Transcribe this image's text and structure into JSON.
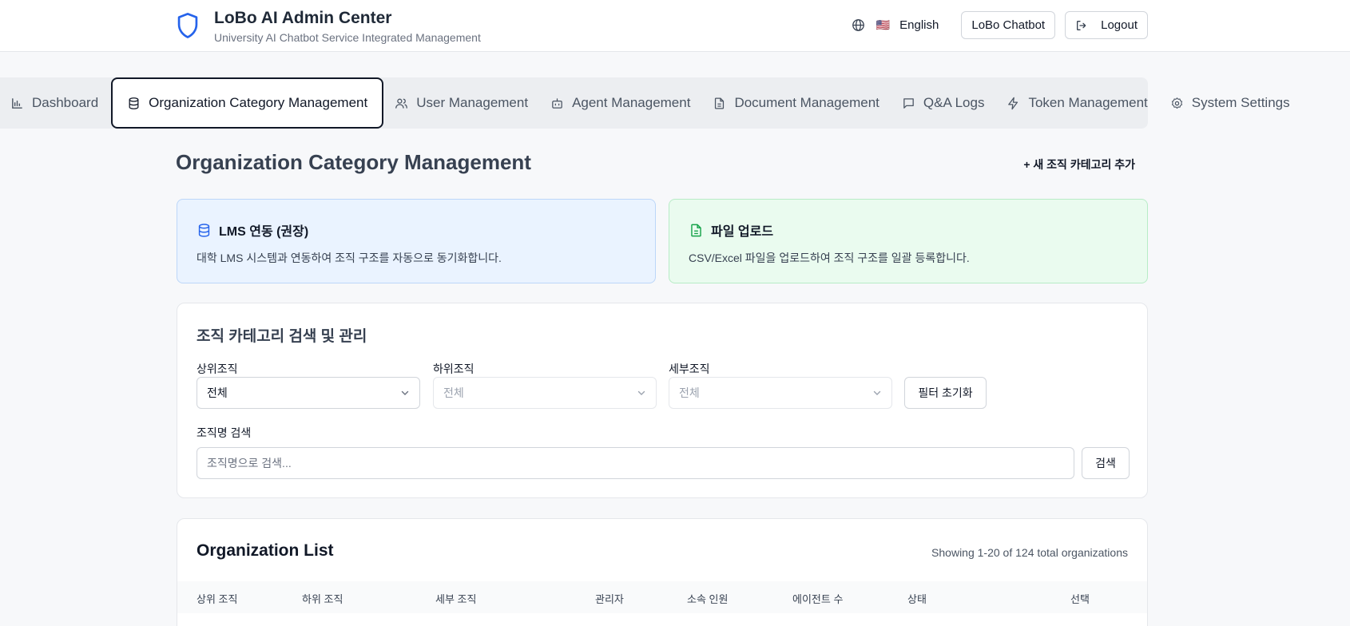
{
  "header": {
    "title": "LoBo AI Admin Center",
    "subtitle": "University AI Chatbot Service Integrated Management",
    "language": "English",
    "flag": "🇺🇸",
    "chatbot_button": "LoBo Chatbot",
    "logout_button": "Logout"
  },
  "nav": {
    "tabs": [
      {
        "label": "Dashboard",
        "icon": "bar-chart-icon"
      },
      {
        "label": "Organization Category Management",
        "icon": "database-icon",
        "active": true
      },
      {
        "label": "User Management",
        "icon": "users-icon"
      },
      {
        "label": "Agent Management",
        "icon": "bot-icon"
      },
      {
        "label": "Document Management",
        "icon": "file-text-icon"
      },
      {
        "label": "Q&A Logs",
        "icon": "message-square-icon"
      },
      {
        "label": "Token Management",
        "icon": "zap-icon"
      },
      {
        "label": "System Settings",
        "icon": "gear-icon"
      }
    ]
  },
  "page": {
    "title": "Organization Category Management",
    "add_button": "+ 새 조직 카테고리 추가"
  },
  "options": {
    "lms": {
      "title": "LMS 연동 (권장)",
      "description": "대학 LMS 시스템과 연동하여 조직 구조를 자동으로 동기화합니다."
    },
    "file": {
      "title": "파일 업로드",
      "description": "CSV/Excel 파일을 업로드하여 조직 구조를 일괄 등록합니다."
    }
  },
  "search": {
    "title": "조직 카테고리 검색 및 관리",
    "parent_label": "상위조직",
    "parent_value": "전체",
    "child_label": "하위조직",
    "child_value": "전체",
    "detail_label": "세부조직",
    "detail_value": "전체",
    "reset_button": "필터 초기화",
    "name_label": "조직명 검색",
    "name_placeholder": "조직명으로 검색...",
    "search_button": "검색"
  },
  "list": {
    "title": "Organization List",
    "count_text": "Showing 1-20 of 124 total organizations",
    "columns": [
      "상위 조직",
      "하위 조직",
      "세부 조직",
      "관리자",
      "소속 인원",
      "에이전트 수",
      "상태",
      "선택"
    ]
  },
  "colors": {
    "brand_blue": "#2563eb",
    "lms_bg": "#eaf3ff",
    "file_bg": "#eafbef",
    "file_icon": "#16a34a"
  }
}
